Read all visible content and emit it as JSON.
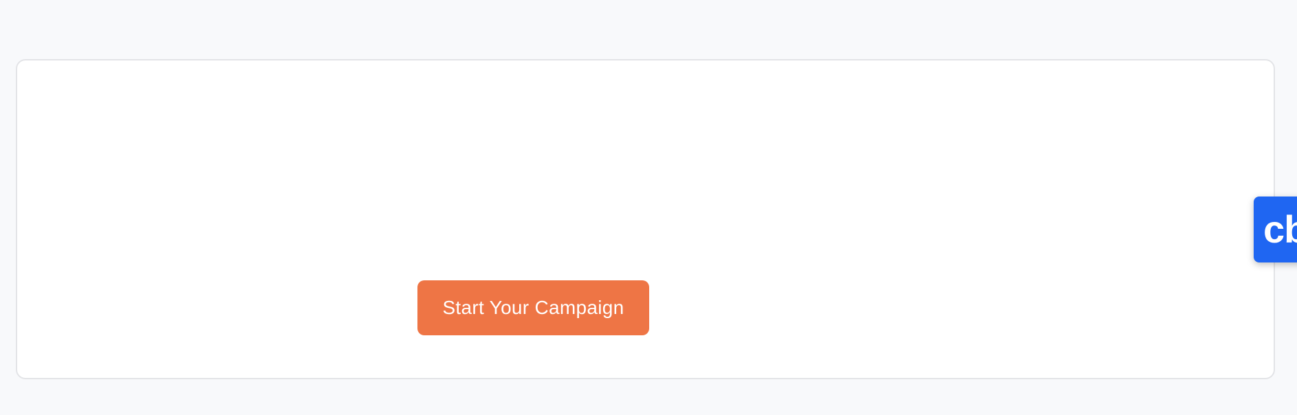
{
  "main": {
    "cta_label": "Start Your Campaign"
  },
  "side_widget": {
    "label": "cb"
  },
  "colors": {
    "page_background": "#f8f9fb",
    "card_background": "#ffffff",
    "card_border": "#e3e4e7",
    "cta_background": "#ee7545",
    "cta_text": "#ffffff",
    "widget_background": "#1f66f2",
    "widget_text": "#ffffff"
  }
}
